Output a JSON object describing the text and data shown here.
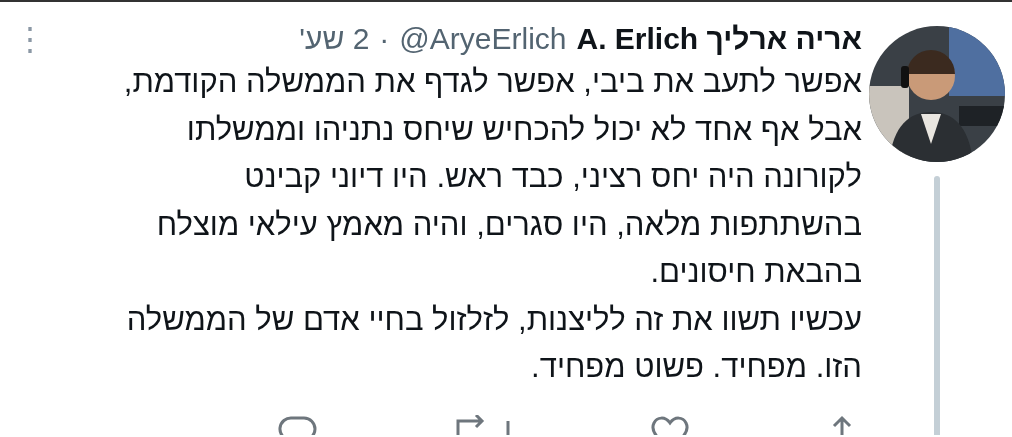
{
  "tweet": {
    "author_name": "אריה ארליך A. Erlich",
    "handle": "@AryeErlich",
    "separator": "·",
    "time": "2 שע'",
    "menu_icon": "⋮",
    "text_lines": [
      "אפשר לתעב את ביבי, אפשר לגדף את הממשלה הקודמת,",
      "אבל אף אחד לא יכול להכחיש שיחס נתניהו וממשלתו",
      "לקורונה היה יחס רציני, כבד ראש. היו דיוני קבינט",
      "בהשתתפות מלאה, היו סגרים, והיה מאמץ עילאי מוצלח",
      "בהבאת חיסונים.",
      "עכשיו תשוו את זה לליצנות, לזלזול בחיי אדם של הממשלה",
      "הזו. מפחיד. פשוט מפחיד."
    ],
    "actions": [
      {
        "kind": "reply"
      },
      {
        "kind": "retweet"
      },
      {
        "kind": "like"
      },
      {
        "kind": "share"
      }
    ]
  }
}
